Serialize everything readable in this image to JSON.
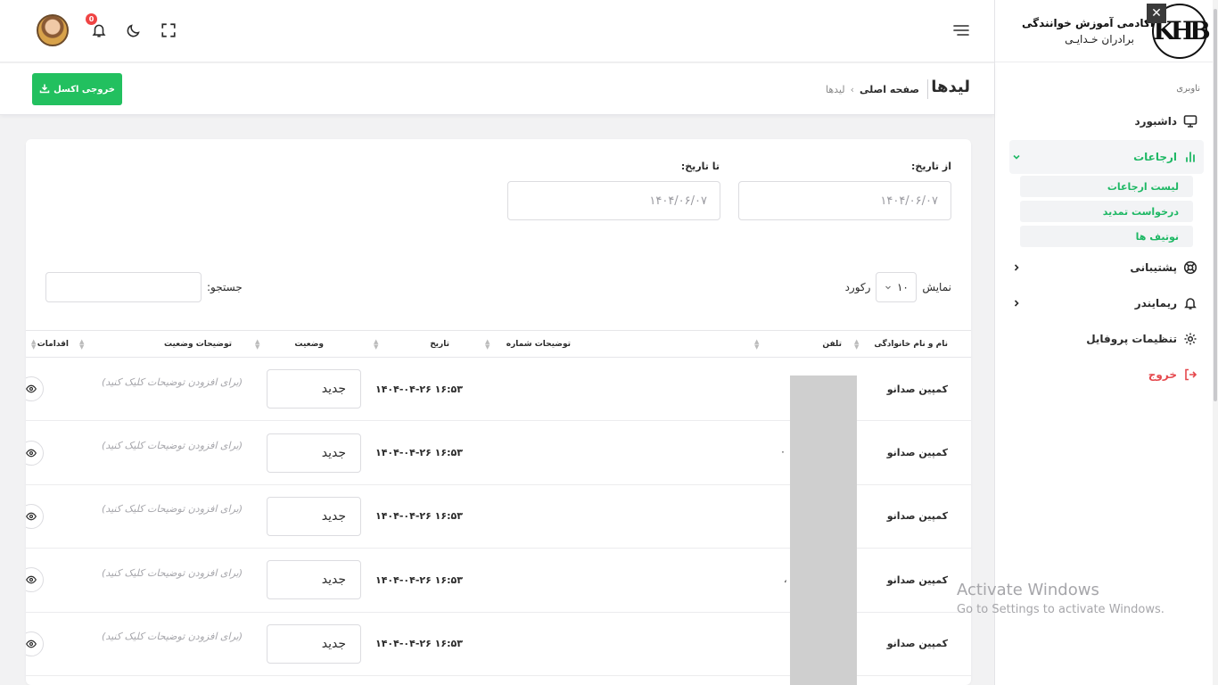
{
  "brand": {
    "title": "آکادمی آموزش خوانندگی",
    "subtitle": "برادران خـدایـی",
    "logo_text": "KHB"
  },
  "sidebar": {
    "caption": "ناوبری",
    "items": [
      {
        "label": "داشبورد",
        "icon": "monitor-icon"
      },
      {
        "label": "ارجاعات",
        "icon": "chart-bars-icon",
        "active": true
      },
      {
        "label": "پشتیبانی",
        "icon": "lifebuoy-icon"
      },
      {
        "label": "ریمایندر",
        "icon": "bell-icon"
      },
      {
        "label": "تنظیمات پروفایل",
        "icon": "gear-icon"
      },
      {
        "label": "خروج",
        "icon": "logout-icon"
      }
    ],
    "submenu": [
      "لیست ارجاعات",
      "درخواست تمدید",
      "نوتیف ها"
    ]
  },
  "topbar": {
    "notification_count": "0"
  },
  "header": {
    "title": "لیدها",
    "breadcrumb_home": "صفحه اصلی",
    "breadcrumb_current": "لیدها",
    "excel_button": "خروجی اکسل"
  },
  "filters": {
    "from_label": "از تاریخ:",
    "to_label": "تا تاریخ:",
    "from_value": "۱۴۰۴/۰۶/۰۷",
    "to_value": "۱۴۰۴/۰۶/۰۷",
    "show_label": "نمایش",
    "page_length": "۱۰",
    "records_label": "رکورد",
    "search_label": "جستجو:"
  },
  "table": {
    "columns": [
      "نام و نام خانوادگی",
      "تلفن",
      "توضیحات شماره",
      "تاریخ",
      "وضعیت",
      "توضیحات وضعیت",
      "اقدامات"
    ],
    "rows": [
      {
        "name": "کمپین صدانو",
        "date": "۱۴۰۴-۰۴-۲۶ ۱۶:۵۳",
        "status": "جدید",
        "status_desc": "(برای افزودن توضیحات کلیک کنید)"
      },
      {
        "name": "کمپین صدانو",
        "date": "۱۴۰۴-۰۴-۲۶ ۱۶:۵۳",
        "status": "جدید",
        "status_desc": "(برای افزودن توضیحات کلیک کنید)"
      },
      {
        "name": "کمپین صدانو",
        "date": "۱۴۰۴-۰۴-۲۶ ۱۶:۵۳",
        "status": "جدید",
        "status_desc": "(برای افزودن توضیحات کلیک کنید)"
      },
      {
        "name": "کمپین صدانو",
        "date": "۱۴۰۴-۰۴-۲۶ ۱۶:۵۳",
        "status": "جدید",
        "status_desc": "(برای افزودن توضیحات کلیک کنید)"
      },
      {
        "name": "کمپین صدانو",
        "date": "۱۴۰۴-۰۴-۲۶ ۱۶:۵۳",
        "status": "جدید",
        "status_desc": "(برای افزودن توضیحات کلیک کنید)"
      }
    ]
  },
  "watermark": {
    "title": "Activate Windows",
    "subtitle": "Go to Settings to activate Windows."
  },
  "colors": {
    "accent": "#22c05f",
    "danger": "#e5484d",
    "badge": "#ef4444"
  }
}
